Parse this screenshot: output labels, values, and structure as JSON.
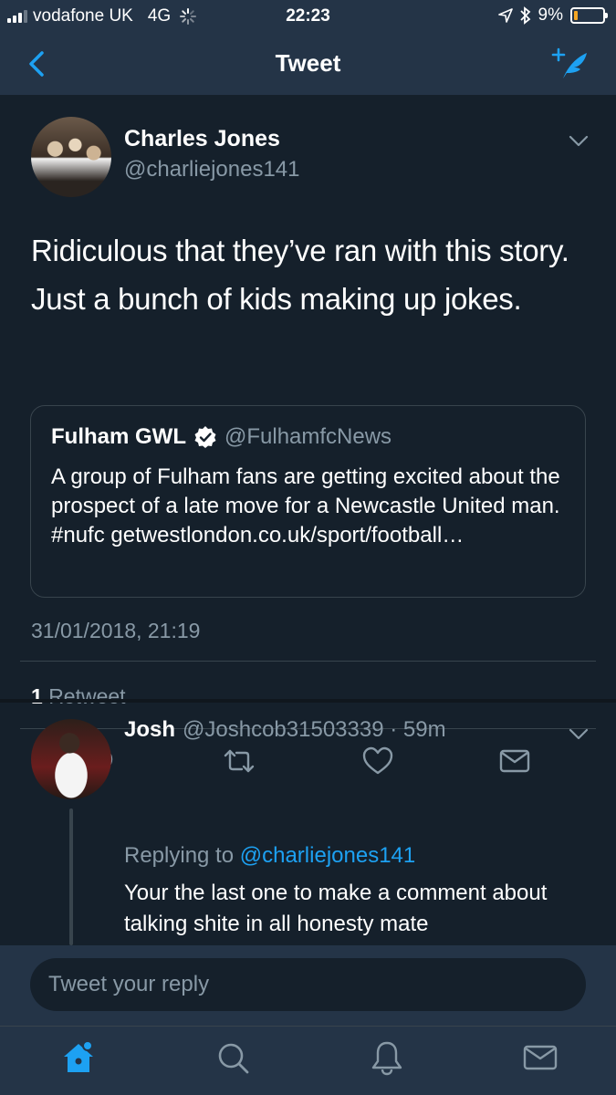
{
  "status_bar": {
    "carrier": "vodafone UK",
    "network": "4G",
    "time": "22:23",
    "battery": "9%",
    "battery_level": 0.09
  },
  "nav": {
    "title": "Tweet",
    "back_icon": "chevron-left-icon",
    "compose_icon": "compose-tweet-icon"
  },
  "tweet": {
    "author_name": "Charles Jones",
    "author_handle": "@charliejones141",
    "text": "Ridiculous that they’ve ran with this story. Just a bunch of kids making up jokes.",
    "quoted": {
      "name": "Fulham GWL",
      "handle": "@FulhamfcNews",
      "text": "A group of Fulham fans are getting excited about the prospect of a late move for a Newcastle United man. #nufc getwestlondon.co.uk/sport/football…"
    },
    "timestamp": "31/01/2018, 21:19",
    "retweet_count": "1",
    "retweet_label": "Retweet"
  },
  "reply": {
    "name": "Josh",
    "handle_time": "@Joshcob31503339 · 59m",
    "replying_prefix": "Replying to",
    "replying_to": "@charliejones141",
    "text": "Your the last one to make a comment about talking shite in all honesty mate"
  },
  "composer": {
    "placeholder": "Tweet your reply"
  },
  "colors": {
    "background": "#15202b",
    "bar": "#243447",
    "accent": "#1da1f2",
    "muted": "#8899a6",
    "battery_low": "#f5a623"
  }
}
